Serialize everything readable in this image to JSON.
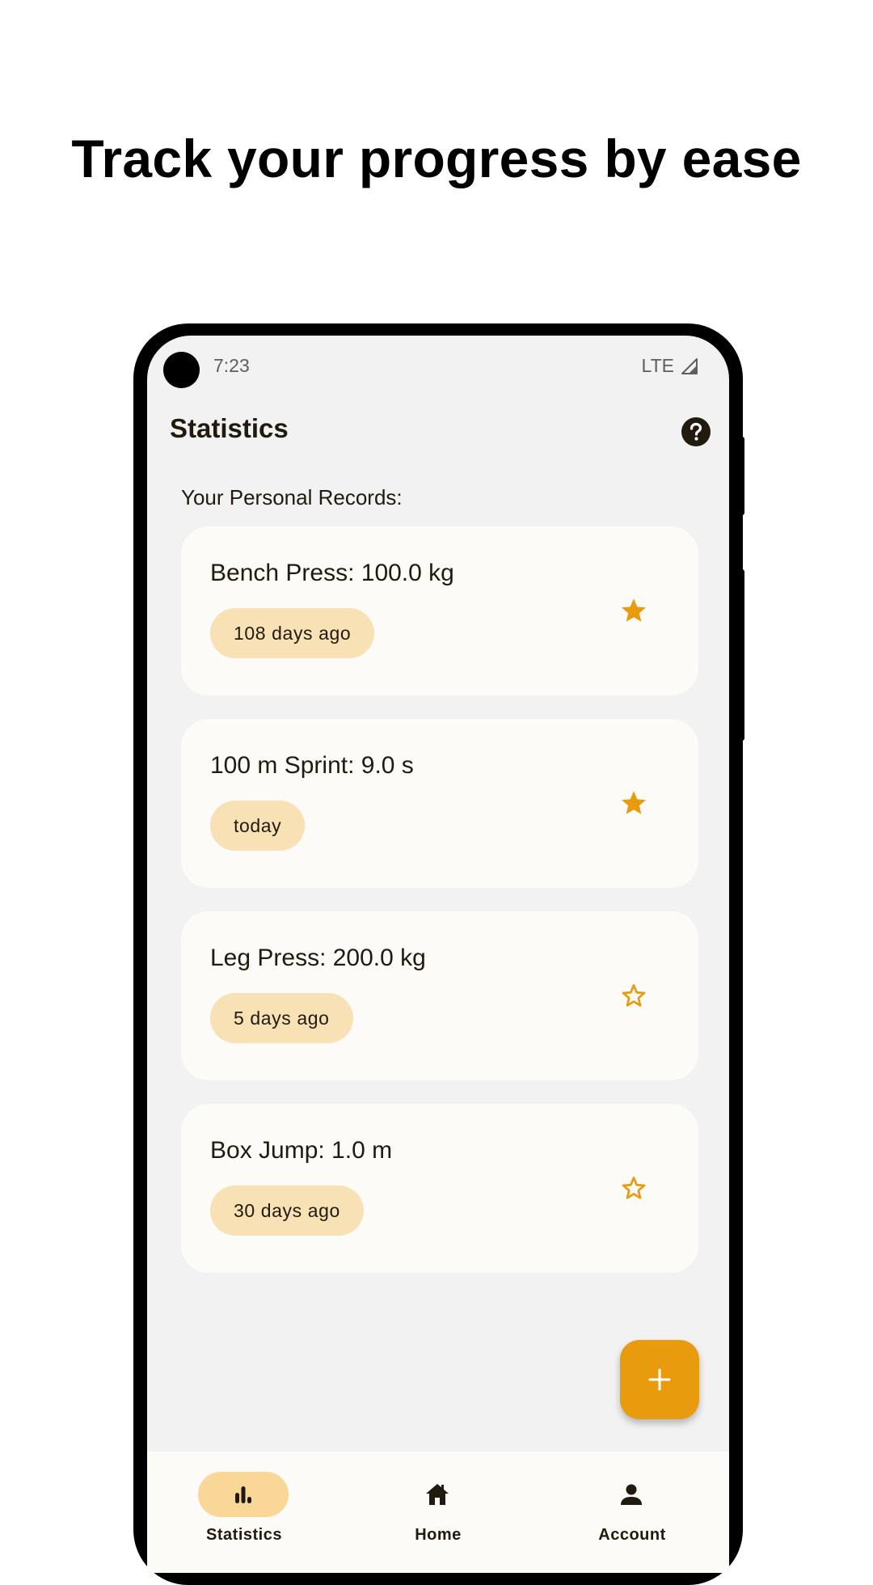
{
  "headline": "Track your progress by ease",
  "status_bar": {
    "time": "7:23",
    "network": "LTE"
  },
  "app_bar": {
    "title": "Statistics",
    "help_icon": "help-circle-icon"
  },
  "section_label": "Your Personal Records:",
  "records": [
    {
      "title": "Bench Press: 100.0 kg",
      "ago": "108 days ago",
      "starred": true
    },
    {
      "title": "100 m Sprint: 9.0 s",
      "ago": "today",
      "starred": true
    },
    {
      "title": "Leg Press: 200.0 kg",
      "ago": "5 days ago",
      "starred": false
    },
    {
      "title": "Box Jump: 1.0 m",
      "ago": "30 days ago",
      "starred": false
    }
  ],
  "fab": {
    "icon": "plus-icon"
  },
  "bottom_nav": {
    "items": [
      {
        "label": "Statistics",
        "icon": "bar-chart-icon",
        "active": true
      },
      {
        "label": "Home",
        "icon": "home-icon",
        "active": false
      },
      {
        "label": "Account",
        "icon": "person-icon",
        "active": false
      }
    ]
  },
  "colors": {
    "accent": "#e89b0c",
    "chip": "#f7e1b5",
    "nav_active": "#f8d797",
    "background": "#f2f2f2",
    "card": "#fcfbf8",
    "text": "#201a0f"
  }
}
